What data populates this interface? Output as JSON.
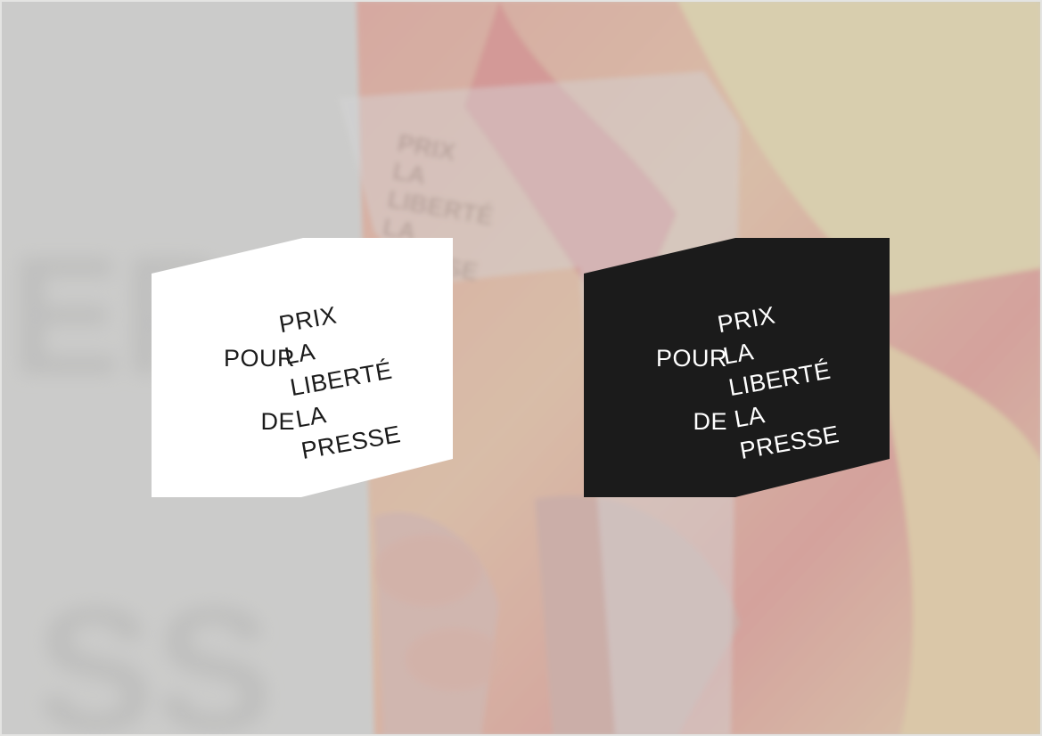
{
  "background": {
    "photo_description_colors": [
      "#c9c9c7",
      "#e8553f",
      "#f2b54a",
      "#f6e3c3"
    ],
    "ghost_text": [
      "PRIX",
      "LA",
      "LIBERTÉ",
      "LA",
      "PRESSE"
    ]
  },
  "logos": {
    "light": {
      "fill": "#ffffff",
      "text_color": "#1b1b1b",
      "left": [
        "POUR",
        "DE"
      ],
      "right": [
        "PRIX",
        "LA",
        "LIBERTÉ",
        "LA",
        "PRESSE"
      ]
    },
    "dark": {
      "fill": "#1b1b1b",
      "text_color": "#ffffff",
      "left": [
        "POUR",
        "DE"
      ],
      "right": [
        "PRIX",
        "LA",
        "LIBERTÉ",
        "LA",
        "PRESSE"
      ]
    }
  }
}
